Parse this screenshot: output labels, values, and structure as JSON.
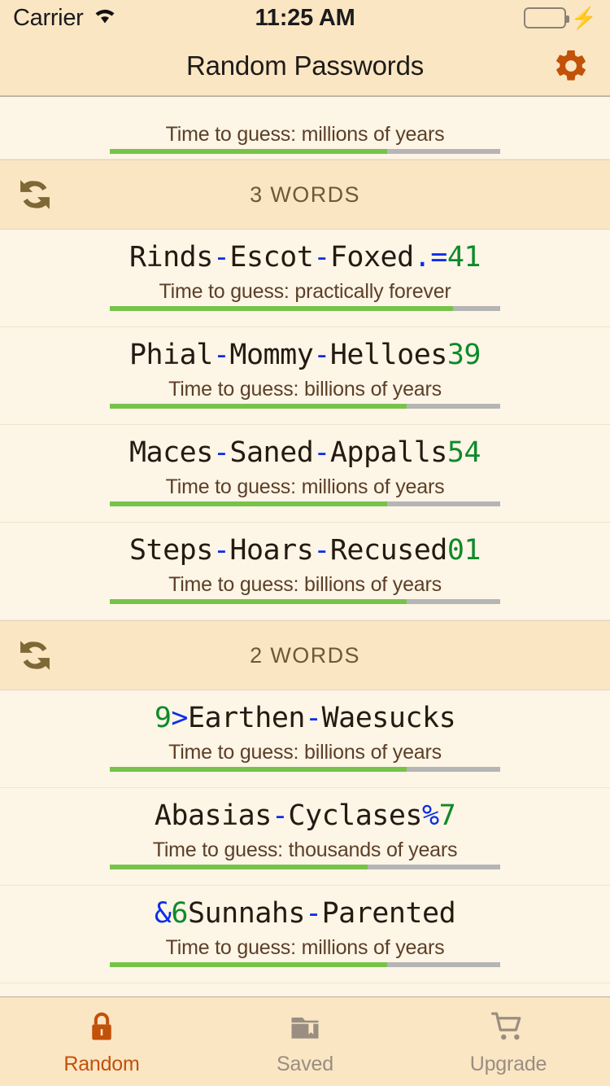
{
  "status_bar": {
    "carrier": "Carrier",
    "time": "11:25 AM",
    "wifi_icon": "wifi-icon",
    "battery_icon": "battery-icon",
    "charging_icon": "lightning-bolt-icon"
  },
  "nav_bar": {
    "title": "Random Passwords",
    "settings_icon": "gear-icon"
  },
  "colors": {
    "word": "#241a12",
    "symbol": "#0b2ee8",
    "number": "#0e8a2a",
    "accent": "#C2510A",
    "bar_fill": "#77c34a",
    "bar_track": "#b5b5b5",
    "header_bg": "#FBE6C4",
    "row_bg": "#FDF5E6"
  },
  "sections": [
    {
      "id": "partial-top",
      "header": null,
      "rows": [
        {
          "partial": true,
          "segments": [],
          "time_label": "Time to guess: millions of years",
          "strength_percent": 71
        }
      ]
    },
    {
      "id": "three-words",
      "header": {
        "title": "3 WORDS",
        "refresh_icon": "refresh-icon"
      },
      "rows": [
        {
          "partial": false,
          "segments": [
            {
              "t": "Rinds",
              "k": "word"
            },
            {
              "t": "-",
              "k": "sym"
            },
            {
              "t": "Escot",
              "k": "word"
            },
            {
              "t": "-",
              "k": "sym"
            },
            {
              "t": "Foxed",
              "k": "word"
            },
            {
              "t": ".=",
              "k": "sym"
            },
            {
              "t": "41",
              "k": "num"
            }
          ],
          "time_label": "Time to guess: practically forever",
          "strength_percent": 88
        },
        {
          "partial": false,
          "segments": [
            {
              "t": "Phial",
              "k": "word"
            },
            {
              "t": "-",
              "k": "sym"
            },
            {
              "t": "Mommy",
              "k": "word"
            },
            {
              "t": "-",
              "k": "sym"
            },
            {
              "t": "Helloes",
              "k": "word"
            },
            {
              "t": "39",
              "k": "num"
            }
          ],
          "time_label": "Time to guess: billions of years",
          "strength_percent": 76
        },
        {
          "partial": false,
          "segments": [
            {
              "t": "Maces",
              "k": "word"
            },
            {
              "t": "-",
              "k": "sym"
            },
            {
              "t": "Saned",
              "k": "word"
            },
            {
              "t": "-",
              "k": "sym"
            },
            {
              "t": "Appalls",
              "k": "word"
            },
            {
              "t": "54",
              "k": "num"
            }
          ],
          "time_label": "Time to guess: millions of years",
          "strength_percent": 71
        },
        {
          "partial": false,
          "segments": [
            {
              "t": "Steps",
              "k": "word"
            },
            {
              "t": "-",
              "k": "sym"
            },
            {
              "t": "Hoars",
              "k": "word"
            },
            {
              "t": "-",
              "k": "sym"
            },
            {
              "t": "Recused",
              "k": "word"
            },
            {
              "t": "01",
              "k": "num"
            }
          ],
          "time_label": "Time to guess: billions of years",
          "strength_percent": 76
        }
      ]
    },
    {
      "id": "two-words",
      "header": {
        "title": "2 WORDS",
        "refresh_icon": "refresh-icon"
      },
      "rows": [
        {
          "partial": false,
          "segments": [
            {
              "t": "9",
              "k": "num"
            },
            {
              "t": ">",
              "k": "sym"
            },
            {
              "t": "Earthen",
              "k": "word"
            },
            {
              "t": "-",
              "k": "sym"
            },
            {
              "t": "Waesucks",
              "k": "word"
            }
          ],
          "time_label": "Time to guess: billions of years",
          "strength_percent": 76
        },
        {
          "partial": false,
          "segments": [
            {
              "t": "Abasias",
              "k": "word"
            },
            {
              "t": "-",
              "k": "sym"
            },
            {
              "t": "Cyclases",
              "k": "word"
            },
            {
              "t": "%",
              "k": "sym"
            },
            {
              "t": "7",
              "k": "num"
            }
          ],
          "time_label": "Time to guess: thousands of years",
          "strength_percent": 66
        },
        {
          "partial": false,
          "segments": [
            {
              "t": "&",
              "k": "sym"
            },
            {
              "t": "6",
              "k": "num"
            },
            {
              "t": "Sunnahs",
              "k": "word"
            },
            {
              "t": "-",
              "k": "sym"
            },
            {
              "t": "Parented",
              "k": "word"
            }
          ],
          "time_label": "Time to guess: millions of years",
          "strength_percent": 71
        }
      ]
    }
  ],
  "tab_bar": {
    "tabs": [
      {
        "label": "Random",
        "icon": "lock-icon",
        "active": true
      },
      {
        "label": "Saved",
        "icon": "bookmark-folder-icon",
        "active": false
      },
      {
        "label": "Upgrade",
        "icon": "shopping-cart-icon",
        "active": false
      }
    ]
  }
}
